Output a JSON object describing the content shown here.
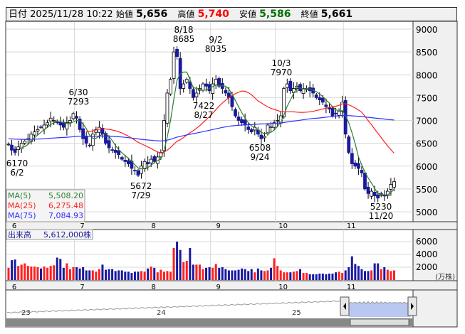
{
  "header": {
    "date_label": "日付",
    "datetime": "2025/11/28 10:22",
    "open_label": "始値",
    "open": "5,656",
    "high_label": "高値",
    "high": "5,740",
    "low_label": "安値",
    "low": "5,586",
    "close_label": "終値",
    "close": "5,661"
  },
  "colors": {
    "up": "#ffffff",
    "down": "#1a1aa0",
    "ma5": "#2e7d32",
    "ma25": "#ff2020",
    "ma75": "#3030ff",
    "vol_up": "#ff2020",
    "vol_down": "#1a1aa0",
    "high": "#ff0000",
    "low": "#007000"
  },
  "chart_data": {
    "type": "candlestick",
    "price_axis": {
      "ticks": [
        "9000",
        "8500",
        "8000",
        "7500",
        "7000",
        "6500",
        "6000",
        "5500",
        "5000"
      ],
      "range": [
        5000,
        9000
      ]
    },
    "month_labels": [
      "6",
      "7",
      "8",
      "9",
      "10",
      "11"
    ],
    "month_lengths": [
      21,
      22,
      20,
      20,
      21,
      16
    ],
    "closes": [
      6480,
      6350,
      6300,
      6420,
      6500,
      6550,
      6600,
      6700,
      6750,
      6800,
      6850,
      6900,
      6950,
      7050,
      7000,
      6950,
      6900,
      6850,
      6950,
      7000,
      7150,
      7050,
      6800,
      6600,
      6500,
      6450,
      6700,
      6800,
      6850,
      6700,
      6500,
      6400,
      6350,
      6300,
      6250,
      6150,
      6100,
      6050,
      5950,
      5900,
      5800,
      6000,
      6100,
      6050,
      6150,
      6100,
      6200,
      6300,
      7000,
      7600,
      7900,
      8500,
      8400,
      7700,
      7800,
      7900,
      7700,
      7500,
      7600,
      7700,
      7800,
      7750,
      7650,
      7800,
      7900,
      7750,
      7700,
      7600,
      7500,
      7300,
      7100,
      7000,
      6950,
      6900,
      6800,
      6750,
      6850,
      6700,
      6600,
      6650,
      6900,
      6850,
      6950,
      7000,
      7100,
      7700,
      7800,
      7650,
      7700,
      7750,
      7650,
      7700,
      7700,
      7650,
      7600,
      7500,
      7450,
      7400,
      7300,
      7250,
      7100,
      7150,
      7200,
      7400,
      6700,
      6300,
      6050,
      6000,
      5950,
      5850,
      5500,
      5400,
      5450,
      5350,
      5300,
      5400,
      5350,
      5450,
      5600,
      5661
    ],
    "volumes": [
      1900,
      3100,
      3200,
      2200,
      2400,
      2600,
      2200,
      2100,
      2100,
      2000,
      1800,
      2100,
      1900,
      2200,
      2300,
      3500,
      3300,
      1900,
      2600,
      1700,
      2000,
      2000,
      1800,
      2000,
      1500,
      1500,
      1500,
      1300,
      1700,
      2400,
      1600,
      1700,
      1700,
      1400,
      1500,
      1500,
      1300,
      1300,
      1100,
      1300,
      1300,
      1400,
      1300,
      1800,
      2100,
      1900,
      1200,
      1600,
      1300,
      1400,
      1300,
      5000,
      6000,
      4700,
      2800,
      3000,
      5000,
      2400,
      2400,
      2400,
      1700,
      1900,
      2000,
      1900,
      2500,
      1900,
      2000,
      1700,
      1500,
      1500,
      1500,
      1600,
      1800,
      1700,
      1400,
      1700,
      1200,
      1800,
      1500,
      1400,
      1500,
      1900,
      3400,
      2200,
      1500,
      1200,
      1200,
      1200,
      1300,
      1400,
      1700,
      1100,
      1100,
      900,
      900,
      900,
      1000,
      1000,
      900,
      1000,
      1000,
      1200,
      1300,
      1100,
      1500,
      2000,
      3700,
      2500,
      2200,
      1700,
      1400,
      1400,
      1500,
      2600,
      2600,
      1700,
      2000,
      1600,
      1400,
      1500,
      1200
    ]
  },
  "annotations": [
    {
      "text": "8/18",
      "sub": "8685"
    },
    {
      "text": "9/2",
      "sub": "8035"
    },
    {
      "text": "10/3",
      "sub": "7970"
    },
    {
      "text": "6/30",
      "sub": "7293"
    },
    {
      "text": "7422",
      "sub": "8/27"
    },
    {
      "text": "6508",
      "sub": "9/24"
    },
    {
      "text": "6170",
      "sub": "6/2"
    },
    {
      "text": "5672",
      "sub": "7/29"
    },
    {
      "text": "5230",
      "sub": "11/20"
    }
  ],
  "legend": {
    "ma5_label": "MA(5)",
    "ma5_value": "5,508.20",
    "ma25_label": "MA(25)",
    "ma25_value": "6,275.48",
    "ma75_label": "MA(75)",
    "ma75_value": "7,084.93"
  },
  "volume": {
    "label": "出来高",
    "value": "5,612,000株",
    "ticks": [
      "6000",
      "4000",
      "2000"
    ],
    "unit": "(万株)"
  },
  "navigator": {
    "year_labels": [
      "23",
      "24",
      "25"
    ]
  }
}
